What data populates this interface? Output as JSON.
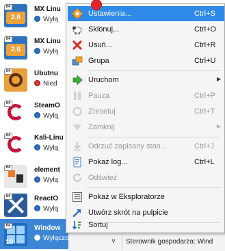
{
  "vm_list": [
    {
      "name": "MX Linu",
      "status": "Wyłą",
      "os": "linux26",
      "os_badge": "2.6"
    },
    {
      "name": "MX Linu",
      "status": "Wyłą",
      "os": "linux26",
      "os_badge": "2.6"
    },
    {
      "name": "Ubutnu",
      "status": "Nied",
      "os": "ubuntu",
      "status_color": "red"
    },
    {
      "name": "SteamO",
      "status": "Wyłą",
      "os": "debian"
    },
    {
      "name": "Kali-Linu",
      "status": "Wyłą",
      "os": "debian"
    },
    {
      "name": "element",
      "status": "Wyłą",
      "os": "other"
    },
    {
      "name": "ReactO",
      "status": "Wyłą",
      "os": "react"
    },
    {
      "name": "Window",
      "status": "Wyłączona",
      "os": "win10",
      "os_badge": "10",
      "selected": true
    }
  ],
  "badge_64": "64",
  "context_menu": {
    "items": [
      {
        "label": "Ustawienia...",
        "shortcut": "Ctrl+S",
        "icon": "gear-icon",
        "highlighted": true
      },
      {
        "label": "Sklonuj...",
        "shortcut": "Ctrl+O",
        "icon": "clone-sheep-icon"
      },
      {
        "label": "Usuń...",
        "shortcut": "Ctrl+R",
        "icon": "delete-x-icon"
      },
      {
        "label": "Grupa",
        "shortcut": "Ctrl+U",
        "icon": "group-icon"
      },
      {
        "label": "Uruchom",
        "shortcut": "",
        "icon": "start-arrow-icon",
        "submenu": true
      },
      {
        "label": "Pauza",
        "shortcut": "Ctrl+P",
        "icon": "pause-icon",
        "disabled": true
      },
      {
        "label": "Zresetuj",
        "shortcut": "Ctrl+T",
        "icon": "reset-icon",
        "disabled": true
      },
      {
        "label": "Zamknij",
        "shortcut": "",
        "icon": "close-vm-icon",
        "disabled": true,
        "submenu": true
      },
      {
        "label": "Odrzuć zapisany stan...",
        "shortcut": "Ctrl+J",
        "icon": "discard-state-icon",
        "disabled": true
      },
      {
        "label": "Pokaż log...",
        "shortcut": "Ctrl+L",
        "icon": "log-icon"
      },
      {
        "label": "Odśwież",
        "shortcut": "",
        "icon": "refresh-icon",
        "disabled": true
      },
      {
        "label": "Pokaż w Eksploratorze",
        "shortcut": "",
        "icon": "explorer-icon"
      },
      {
        "label": "Utwórz skrót na pulpicie",
        "shortcut": "",
        "icon": "shortcut-icon"
      },
      {
        "label": "Sortuj",
        "shortcut": "",
        "icon": "sort-icon"
      }
    ]
  },
  "details": {
    "label": "Sterownik gospodarza: Wind",
    "chevron": "v"
  },
  "colors": {
    "highlight": "#2e8ae6",
    "selected_vm": "#3d86d6",
    "pointer_dot": "#e3262d"
  }
}
